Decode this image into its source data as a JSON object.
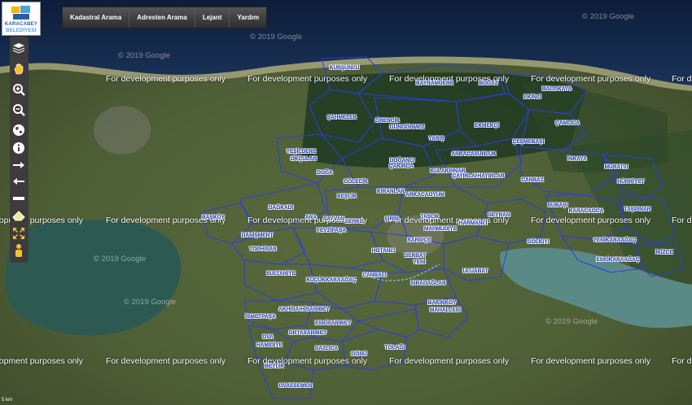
{
  "app": {
    "logo_line1": "KARACABEY",
    "logo_line2": "BELEDİYESİ"
  },
  "toolbar": {
    "items": [
      "Kadastral Arama",
      "Adresten Arama",
      "Lejant",
      "Yardım"
    ]
  },
  "side_tools": [
    "layers-icon",
    "pan-hand-icon",
    "zoom-in-icon",
    "zoom-out-icon",
    "globe-icon",
    "info-icon",
    "arrow-right-icon",
    "arrow-left-icon",
    "ruler-icon",
    "eraser-icon",
    "fullscreen-icon",
    "street-view-icon"
  ],
  "watermarks": {
    "dev_text": "For development purposes only",
    "copyright": "© 2019 Google"
  },
  "scale_text": "5 km",
  "places": [
    "KURŞUNLU",
    "BAYRAMDERE",
    "BOĞAZ",
    "EKİNLİ",
    "BALLIKAYA",
    "ŞAHMELEK",
    "ÖRENCİK",
    "GÜNGÖRMEZ",
    "EKMEKÇİ",
    "ÇAMLICA",
    "YARIŞ",
    "ÇEŞMEBAŞI",
    "YEŞİLDERE",
    "OKÇULAR",
    "DOĞANCI",
    "ÇAKIRCA",
    "ARKACASURLUK",
    "İNKAYA",
    "MURATLI",
    "DOĞA",
    "GÖLECİK",
    "KULAKPINAR",
    "ÇAYIRLAR",
    "HAYIRLAR",
    "CANBAZ",
    "HÜRRİYET",
    "KIRANLAR",
    "ARKACAOYUM",
    "KEŞLİK",
    "SUBAŞI",
    "DAĞKADI",
    "BAŞKÖY",
    "KARACAOCA",
    "TAŞPINAR",
    "SAYVAN",
    "ARA",
    "SERKE",
    "TAŞLIK",
    "MAHMUDİYE",
    "HARMANLI",
    "SEYRAN",
    "DANİŞMENT",
    "FEVZİPAŞA",
    "HOTANLI",
    "TOPHİSAR",
    "GÖLKIYI",
    "YENİKARAAĞAÇ",
    "İKİZCE",
    "ESKİKARAAĞAÇ",
    "SULTANİYE",
    "KÜÇÜKKARAAĞAÇ",
    "CANBALI",
    "ULUABAT",
    "SIRADAĞLAR",
    "AKHİSAR",
    "HİSARIBEY",
    "İSMETPAŞA",
    "BAKIRKÖY",
    "MAHALLESİ",
    "ESKİSARIBEY",
    "OVA",
    "HAMİDİYE",
    "ORTASARIBEY",
    "SAZLICA",
    "BEYLİK",
    "TOLAĞI",
    "GÖNÜ",
    "OVAESEMEN",
    "SARIPÇE",
    "YENİ",
    "ŞİRİN",
    "SERBAT"
  ]
}
